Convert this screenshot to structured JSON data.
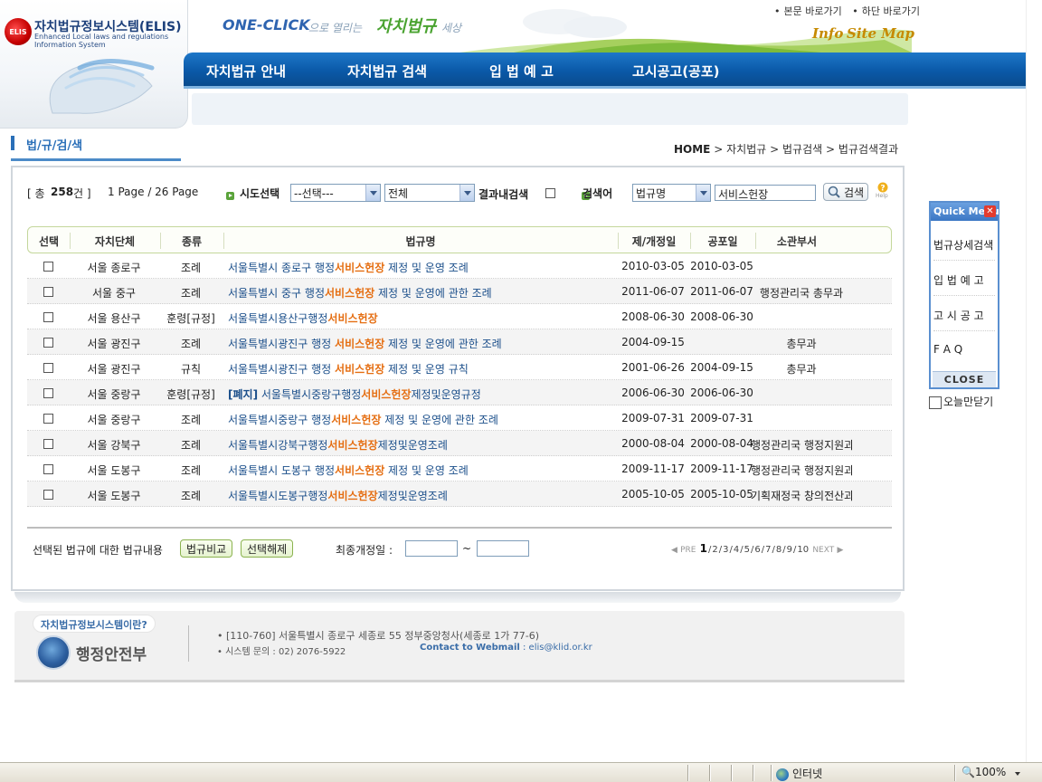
{
  "header": {
    "logo_badge": "ELIS",
    "logo_title": "자치법규정보시스템(ELIS)",
    "logo_sub1": "Enhanced Local laws and regulations",
    "logo_sub2": "Information System",
    "slogan_en": "ONE-CLICK",
    "slogan_mid": "으로 열리는",
    "slogan_main": "자치법규",
    "slogan_end": "세상",
    "skip_body": "본문 바로가기",
    "skip_bottom": "하단 바로가기",
    "info": "Info",
    "sitemap": "Site Map"
  },
  "nav": {
    "items": [
      "자치법규 안내",
      "자치법규 검색",
      "입 법 예 고",
      "고시공고(공포)"
    ]
  },
  "page": {
    "title": "법/규/검/색",
    "breadcrumb": {
      "home": "HOME",
      "sep": ">",
      "items": [
        "자치법규",
        "법규검색",
        "법규검색결과"
      ]
    }
  },
  "search": {
    "total_prefix": "[ 총",
    "total_count": "258",
    "total_suffix": "건 ]",
    "page_info": "1 Page / 26 Page",
    "region_label": "시도선택",
    "region_value": "--선택---",
    "scope_value": "전체",
    "within_label": "결과내검색",
    "keyword_label": "검색어",
    "field_value": "법규명",
    "keyword_value": "서비스헌장",
    "search_button": "검색",
    "help": "Help"
  },
  "table": {
    "headers": [
      "선택",
      "자치단체",
      "종류",
      "법규명",
      "제/개정일",
      "공포일",
      "소관부서"
    ],
    "rows": [
      {
        "org": "서울 종로구",
        "type": "조례",
        "tag": "",
        "pre": "서울특별시 종로구 행정",
        "hl": "서비스헌장",
        "post": " 제정 및 운영 조례",
        "enacted": "2010-03-05",
        "promulgated": "2010-03-05",
        "dept": ""
      },
      {
        "org": "서울 중구",
        "type": "조례",
        "tag": "",
        "pre": "서울특별시 중구 행정",
        "hl": "서비스헌장",
        "post": " 제정 및 운영에 관한 조례",
        "enacted": "2011-06-07",
        "promulgated": "2011-06-07",
        "dept": "행정관리국 총무과"
      },
      {
        "org": "서울 용산구",
        "type": "훈령[규정]",
        "tag": "",
        "pre": "서울특별시용산구행정",
        "hl": "서비스헌장",
        "post": "",
        "enacted": "2008-06-30",
        "promulgated": "2008-06-30",
        "dept": ""
      },
      {
        "org": "서울 광진구",
        "type": "조례",
        "tag": "",
        "pre": "서울특별시광진구 행정 ",
        "hl": "서비스헌장",
        "post": " 제정 및 운영에 관한 조례",
        "enacted": "2004-09-15",
        "promulgated": "",
        "dept": "총무과"
      },
      {
        "org": "서울 광진구",
        "type": "규칙",
        "tag": "",
        "pre": "서울특별시광진구 행정 ",
        "hl": "서비스헌장",
        "post": " 제정 및 운영 규칙",
        "enacted": "2001-06-26",
        "promulgated": "2004-09-15",
        "dept": "총무과"
      },
      {
        "org": "서울 중랑구",
        "type": "훈령[규정]",
        "tag": "[폐지]",
        "pre": " 서울특별시중랑구행정",
        "hl": "서비스헌장",
        "post": "제정및운영규정",
        "enacted": "2006-06-30",
        "promulgated": "2006-06-30",
        "dept": ""
      },
      {
        "org": "서울 중랑구",
        "type": "조례",
        "tag": "",
        "pre": "서울특별시중랑구 행정",
        "hl": "서비스헌장",
        "post": " 제정 및 운영에 관한 조례",
        "enacted": "2009-07-31",
        "promulgated": "2009-07-31",
        "dept": ""
      },
      {
        "org": "서울 강북구",
        "type": "조례",
        "tag": "",
        "pre": "서울특별시강북구행정",
        "hl": "서비스헌장",
        "post": "제정및운영조례",
        "enacted": "2000-08-04",
        "promulgated": "2000-08-04",
        "dept": "행정관리국 행정지원과"
      },
      {
        "org": "서울 도봉구",
        "type": "조례",
        "tag": "",
        "pre": "서울특별시 도봉구 행정",
        "hl": "서비스헌장",
        "post": " 제정 및 운영 조례",
        "enacted": "2009-11-17",
        "promulgated": "2009-11-17",
        "dept": "행정관리국 행정지원과"
      },
      {
        "org": "서울 도봉구",
        "type": "조례",
        "tag": "",
        "pre": "서울특별시도봉구행정",
        "hl": "서비스헌장",
        "post": "제정및운영조례",
        "enacted": "2005-10-05",
        "promulgated": "2005-10-05",
        "dept": "기획재정국 창의전산과"
      }
    ]
  },
  "actions": {
    "selected_label": "선택된 법규에 대한 법규내용",
    "compare_button": "법규비교",
    "deselect_button": "선택해제",
    "last_revision_label": "최종개정일 :",
    "range_sep": "~"
  },
  "pagination": {
    "prev": "PRE",
    "pages": [
      "1",
      "2",
      "3",
      "4",
      "5",
      "6",
      "7",
      "8",
      "9",
      "10"
    ],
    "current": "1",
    "next": "NEXT"
  },
  "footer": {
    "about_badge": "자치법규정보시스템이란?",
    "ministry_name": "행정안전부",
    "address": "• [110-760] 서울특별시 종로구 세종로 55 정부중앙청사(세종로 1가 77-6)",
    "phone": "• 시스템 문의 : 02) 2076-5922",
    "contact_label": "Contact to Webmail",
    "contact_email": " : elis@klid.or.kr"
  },
  "quick_menu": {
    "title": "Quick Menu",
    "items": [
      "법규상세검색",
      "입 법 예 고",
      "고 시 공 고",
      "F   A   Q"
    ],
    "close": "CLOSE",
    "today_close": "오늘만닫기"
  },
  "status_bar": {
    "zone": "인터넷",
    "zoom": "100%"
  },
  "colors": {
    "nav_blue": "#0a59a8",
    "highlight_orange": "#e56e12",
    "link_blue": "#1a4e8a",
    "header_green_border": "#c4d79c"
  }
}
